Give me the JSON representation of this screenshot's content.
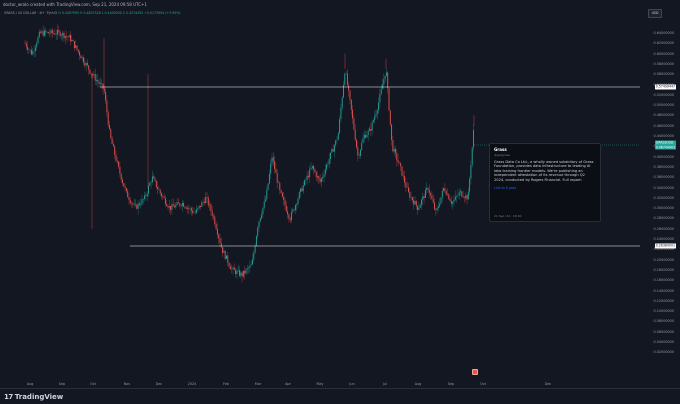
{
  "header": {
    "text": "doctor_wrolo created with TradingView.com, Sep 21, 2024 09:58 UTC+1"
  },
  "symbol_line": {
    "text": "GRASS / US DOLLAR · 4H · PythOI",
    "ohlc": "O 0.4497593  H 0.4807528  L 0.4400000  C 0.4574492  +0.0173994 (+3.95%)"
  },
  "price_axis": {
    "currency": "USD",
    "ticks": [
      "0.64000000",
      "0.62000000",
      "0.60000000",
      "0.58000000",
      "0.56000000",
      "0.54000000",
      "0.52000000",
      "0.50000000",
      "0.48000000",
      "0.46000000",
      "0.44000000",
      "0.42000000",
      "0.40000000",
      "0.38000000",
      "0.36000000",
      "0.34000000",
      "0.32000000",
      "0.30000000",
      "0.28000000",
      "0.26000000",
      "0.24000000",
      "0.22000000",
      "0.20000000",
      "0.18000000",
      "0.16000000",
      "0.14000000",
      "0.12000000",
      "0.10000000",
      "0.08000000",
      "0.06000000",
      "0.04000000",
      "0.02000000"
    ],
    "labels": {
      "upper_line": "0.57499447",
      "current_symbol": "GRASSUSD",
      "current_price": "0.46744903",
      "current_sub": "02:01:26",
      "lower_line": "0.26384001"
    }
  },
  "time_axis": {
    "ticks": [
      "Aug",
      "Sep",
      "Oct",
      "Nov",
      "Dec",
      "2024",
      "Feb",
      "Mar",
      "Apr",
      "May",
      "Jun",
      "Jul",
      "Aug",
      "Sep",
      "Oct",
      "Dec"
    ]
  },
  "news": {
    "title": "Grass",
    "handle": "@getgrass",
    "body": "Grass Data Co Ltd., a wholly owned subsidiary of Grass Foundation, provides data infrastructure to leading AI labs training frontier models. We're publishing an independent attestation of its revenue through Q2 2024, conducted by Rogers Financial. Full report:",
    "link": "Link to X post",
    "time": "21 Sep '24 · 18:00"
  },
  "footer": {
    "brand": "TradingView"
  },
  "colors": {
    "background": "#131722",
    "up": "#26a69a",
    "down": "#ef5350",
    "levels": "#ffffff"
  }
}
